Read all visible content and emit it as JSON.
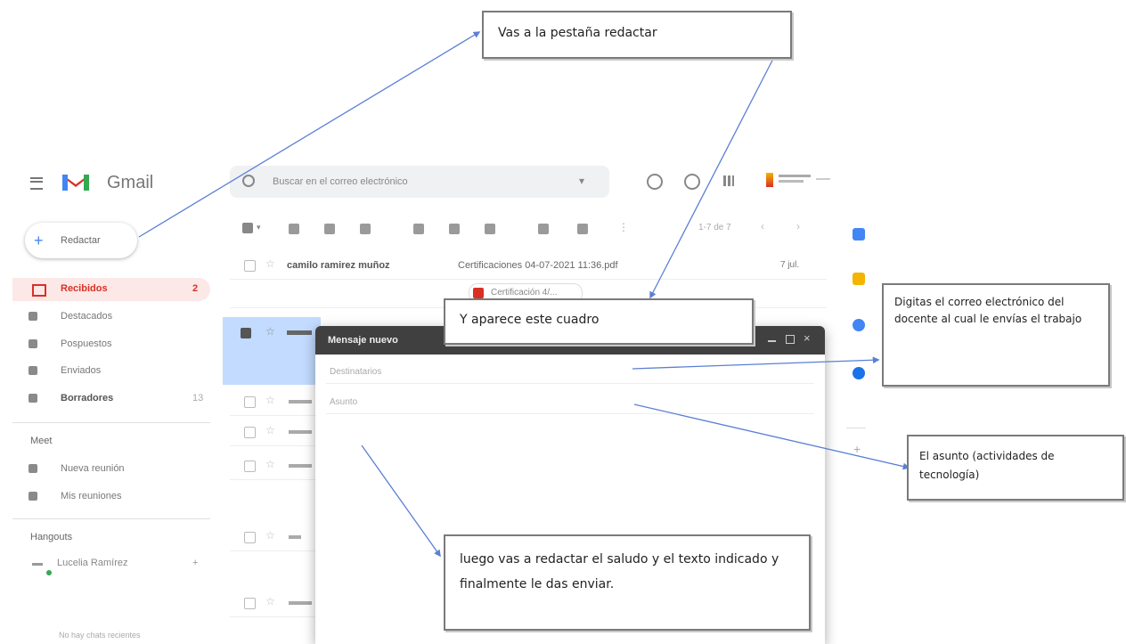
{
  "gmail": {
    "logo_text": "Gmail",
    "search_placeholder": "Buscar en el correo electrónico",
    "compose_label": "Redactar",
    "nav_items": [
      {
        "label": "Recibidos",
        "count": "2",
        "active": true
      },
      {
        "label": "Destacados",
        "count": "",
        "active": false
      },
      {
        "label": "Pospuestos",
        "count": "",
        "active": false
      },
      {
        "label": "Enviados",
        "count": "",
        "active": false
      },
      {
        "label": "Borradores",
        "count": "13",
        "active": false
      }
    ],
    "meet_header": "Meet",
    "meet_items": [
      "Nueva reunión",
      "Mis reuniones"
    ],
    "hangouts_header": "Hangouts",
    "hangouts_user": "Lucelia Ramírez",
    "hangouts_footer": "No hay chats recientes",
    "pagination": "1-7 de 7",
    "first_email": {
      "sender": "camilo ramirez muñoz",
      "subject": "Certificaciones 04-07-2021 11:36.pdf",
      "time": "7 jul.",
      "attachment": "Certificación 4/..."
    },
    "compose_window": {
      "title": "Mensaje nuevo",
      "to_placeholder": "Destinatarios",
      "subject_placeholder": "Asunto"
    }
  },
  "callouts": {
    "c1": "Vas a la pestaña redactar",
    "c2": "Y aparece este cuadro",
    "c3": "Digitas el correo electrónico del docente al cual le envías el trabajo",
    "c4": "El asunto (actividades de tecnología)",
    "c5": "luego vas a redactar el saludo y el texto indicado y finalmente le das enviar."
  },
  "colors": {
    "gmail_red": "#d93025",
    "active_bg": "#fce8e6",
    "selected_row_bg": "#c2dbff",
    "compose_header_bg": "#404040",
    "arrow": "#5b7fd4"
  },
  "icons": [
    "menu-icon",
    "gmail-logo-icon",
    "search-icon",
    "help-icon",
    "settings-icon",
    "apps-icon",
    "compose-plus-icon",
    "inbox-icon",
    "star-icon",
    "clock-icon",
    "send-icon",
    "draft-icon",
    "video-icon",
    "keyboard-icon"
  ]
}
